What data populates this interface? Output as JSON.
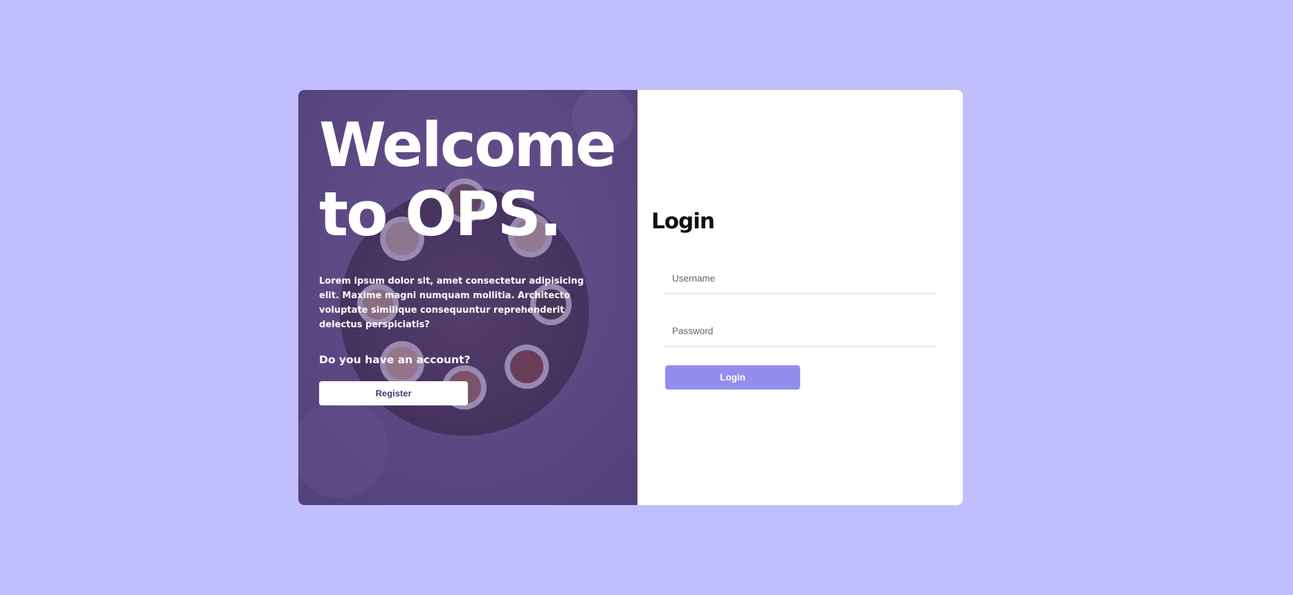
{
  "theme": {
    "page_background": "#c0befd",
    "overlay_color": "#5f4d82",
    "accent": "#958ded",
    "card_background": "#ffffff"
  },
  "hero": {
    "title_line1": "Welcome",
    "title_line2": "to OPS.",
    "description": "Lorem ipsum dolor sit, amet consectetur adipisicing elit. Maxime magni numquam mollitia. Architecto voluptate similique consequuntur reprehenderit delectus perspiciatis?",
    "account_question": "Do you have an account?",
    "register_label": "Register",
    "background_image": "coffee-cups-on-round-wooden-table"
  },
  "login": {
    "title": "Login",
    "username_placeholder": "Username",
    "password_placeholder": "Password",
    "submit_label": "Login"
  }
}
